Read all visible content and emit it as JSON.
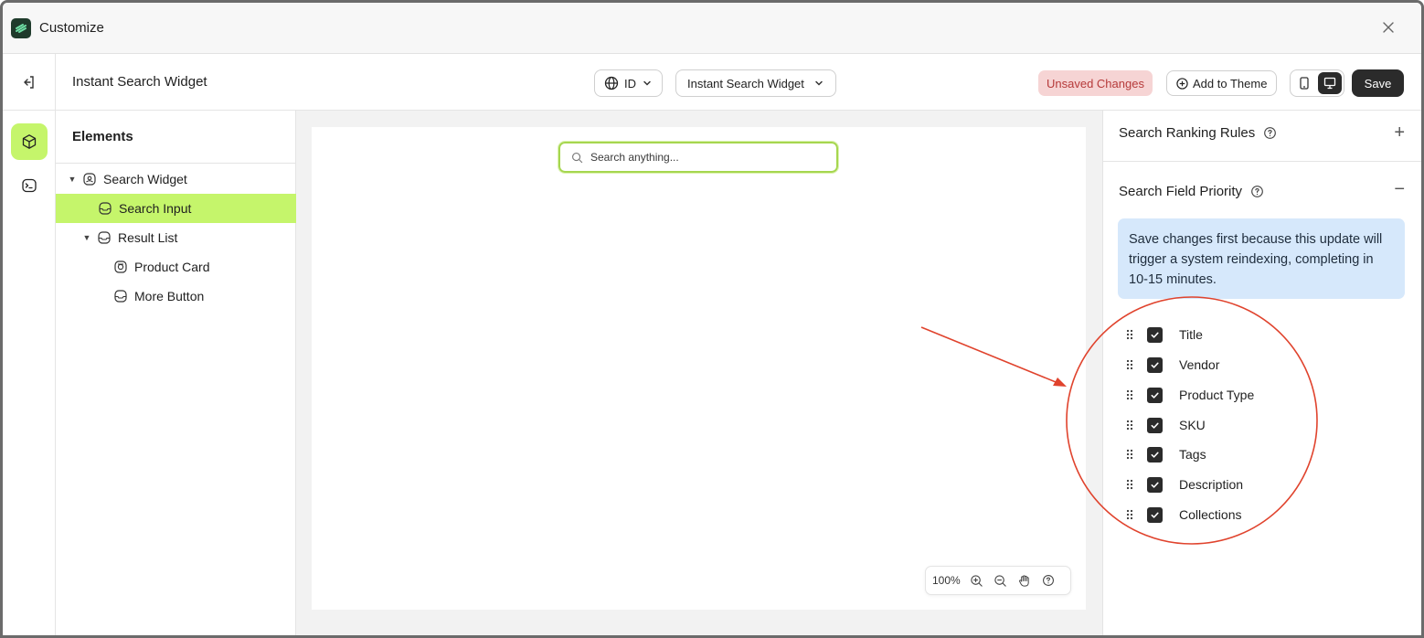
{
  "window": {
    "title": "Customize"
  },
  "toolbar": {
    "widget_name": "Instant Search Widget",
    "language": "ID",
    "widget_select": "Instant Search Widget",
    "unsaved": "Unsaved Changes",
    "add_to_theme": "Add to Theme",
    "save": "Save"
  },
  "elements": {
    "heading": "Elements",
    "items": [
      {
        "label": "Search Widget"
      },
      {
        "label": "Search Input"
      },
      {
        "label": "Result List"
      },
      {
        "label": "Product Card"
      },
      {
        "label": "More Button"
      }
    ]
  },
  "canvas": {
    "search_placeholder": "Search anything...",
    "zoom": "100%"
  },
  "panel": {
    "ranking_title": "Search Ranking Rules",
    "ranking_toggle": "+",
    "priority_title": "Search Field Priority",
    "priority_toggle": "−",
    "notice": "Save changes first because this update will trigger a system reindexing, completing in 10-15 minutes.",
    "fields": [
      {
        "label": "Title",
        "checked": true
      },
      {
        "label": "Vendor",
        "checked": true
      },
      {
        "label": "Product Type",
        "checked": true
      },
      {
        "label": "SKU",
        "checked": true
      },
      {
        "label": "Tags",
        "checked": true
      },
      {
        "label": "Description",
        "checked": true
      },
      {
        "label": "Collections",
        "checked": true
      }
    ]
  },
  "colors": {
    "accent": "#c5f56b",
    "annotation": "#e0432d",
    "notice_bg": "#d6e8fb",
    "unsaved_bg": "#f6d4d4"
  }
}
